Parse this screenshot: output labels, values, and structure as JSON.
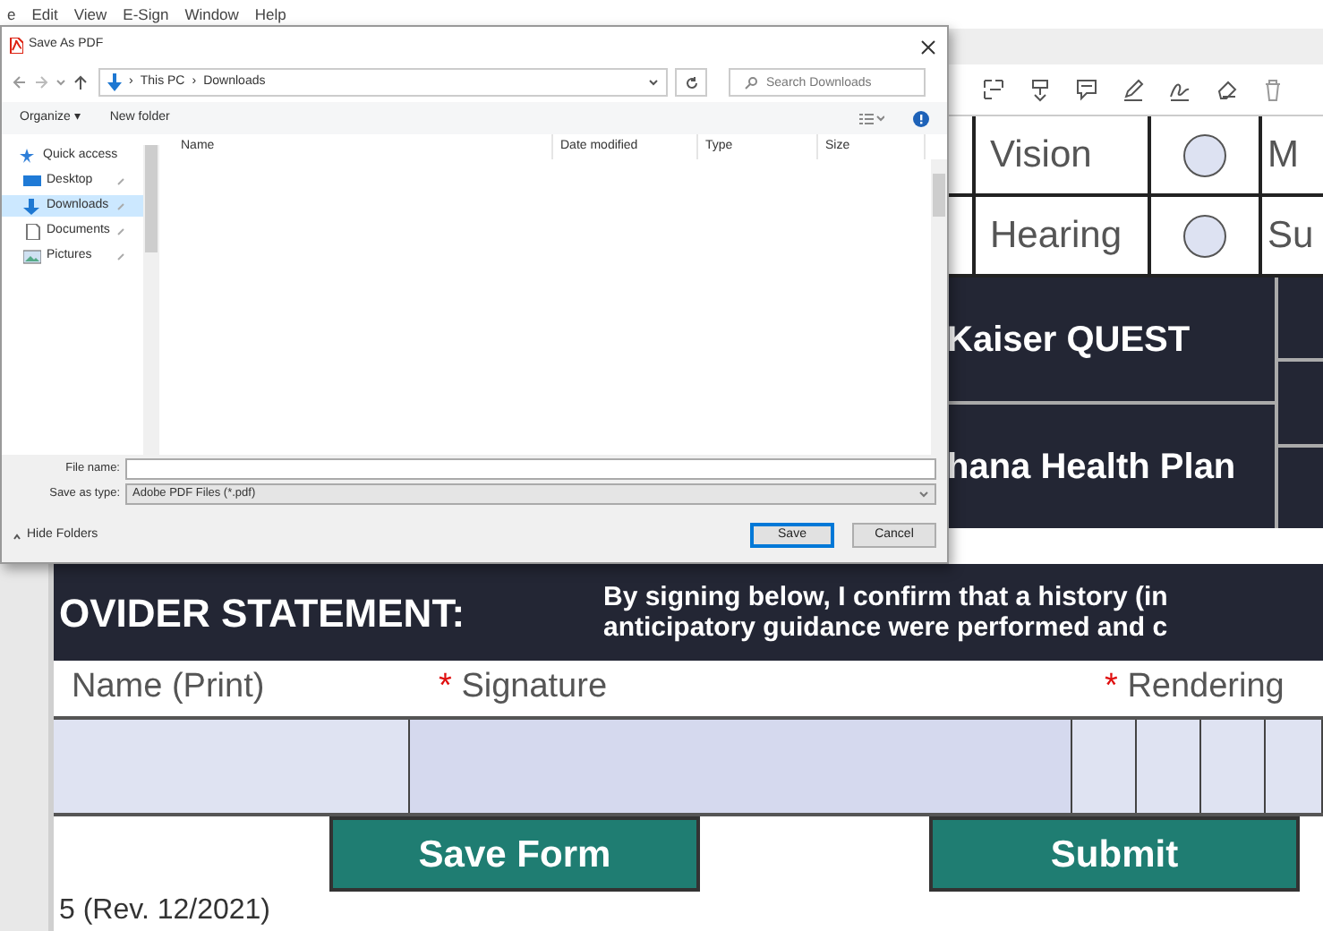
{
  "menu": [
    "e",
    "Edit",
    "View",
    "E-Sign",
    "Window",
    "Help"
  ],
  "dialog": {
    "title": "Save As PDF",
    "path": [
      "This PC",
      "Downloads"
    ],
    "separator": "›",
    "search": {
      "placeholder": "Search Downloads"
    },
    "commands": [
      "Organize ▾",
      "New folder"
    ],
    "nav": [
      {
        "label": "Quick access",
        "kind": "header",
        "selected": false
      },
      {
        "label": "Desktop",
        "kind": "desktop",
        "selected": false
      },
      {
        "label": "Downloads",
        "kind": "downloads",
        "selected": true
      },
      {
        "label": "Documents",
        "kind": "documents",
        "selected": false
      },
      {
        "label": "Pictures",
        "kind": "pictures",
        "selected": false
      }
    ],
    "columns": [
      "Name",
      "Date modified",
      "Type",
      "Size"
    ],
    "file_name": {
      "label": "File name:"
    },
    "save_type": {
      "label": "Save as type:",
      "value": "Adobe PDF Files (*.pdf)"
    },
    "hide_folders": "Hide Folders",
    "buttons": [
      {
        "label": "Save",
        "default": true
      },
      {
        "label": "Cancel",
        "default": false
      }
    ]
  },
  "screening": [
    {
      "label": "Vision",
      "checked": false,
      "next": "M"
    },
    {
      "label": "Hearing",
      "checked": false,
      "next": "Su"
    }
  ],
  "plans": [
    "Kaiser QUEST",
    "hana Health Plan"
  ],
  "provider": {
    "heading": "OVIDER STATEMENT:",
    "lines": [
      "By signing below, I confirm that a history (in",
      "anticipatory guidance were performed and c"
    ]
  },
  "fields": [
    {
      "label": "Name (Print)"
    },
    {
      "label": "Signature",
      "marker": "*"
    },
    {
      "label": "Rendering",
      "marker": "*"
    }
  ],
  "actions": [
    "Save Form",
    "Submit"
  ],
  "footer": "5 (Rev. 12/2021)"
}
